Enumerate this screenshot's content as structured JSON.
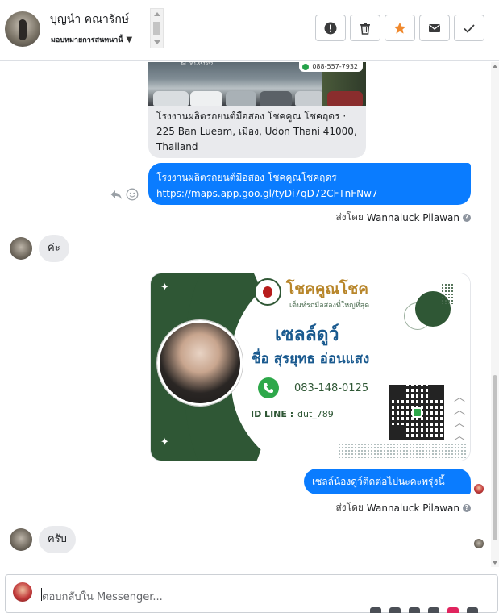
{
  "header": {
    "contact_name": "บุญนำ คณารักษ์",
    "assign_label": "มอบหมายการสนทนานี้",
    "actions": [
      {
        "name": "mark-spam",
        "icon": "alert-icon"
      },
      {
        "name": "delete",
        "icon": "trash-icon"
      },
      {
        "name": "star",
        "icon": "star-icon"
      },
      {
        "name": "mark-unread",
        "icon": "envelope-icon"
      },
      {
        "name": "mark-done",
        "icon": "check-icon"
      }
    ]
  },
  "messages": {
    "link_preview": {
      "phone": "088-557-7932",
      "image_tag": "Tel. 061-557932",
      "title": "โรงงานผลิตรถยนต์มือสอง โชคคูณ โชคฤดร · 225 Ban Lueam, เมือง, Udon Thani 41000, Thailand"
    },
    "link_bubble": {
      "text": "โรงงานผลิตรถยนต์มือสอง โชคคูณโชคฤดร",
      "url": "https://maps.app.goo.gl/tyDi7qD72CFTnFNw7"
    },
    "sent_by_1": {
      "prefix": "ส่งโดย",
      "who": "Wannaluck Pilawan"
    },
    "incoming_1": "ค่ะ",
    "business_card": {
      "brand": "โชคคูณโชค",
      "tagline": "เต็นท์รถมือสองที่ใหญ่ที่สุด",
      "role": "เซลล์ดูว์",
      "name": "ชื่อ สุรยุทธ อ่อนแสง",
      "phone": "083-148-0125",
      "id_line_label": "ID LINE :",
      "id_line_value": "dut_789"
    },
    "plan_bubble": "เซลล์น้องดูว์ติดต่อไปนะคะพรุ่งนี้",
    "sent_by_2": {
      "prefix": "ส่งโดย",
      "who": "Wannaluck Pilawan"
    },
    "incoming_2": "ครับ"
  },
  "reply": {
    "placeholder": "ตอบกลับใน Messenger..."
  },
  "colors": {
    "outgoing_bubble": "#0a7cff",
    "incoming_bubble": "#e9eaed",
    "star": "#f0892d",
    "card_green": "#2f5735",
    "card_blue": "#1a5a8f"
  }
}
